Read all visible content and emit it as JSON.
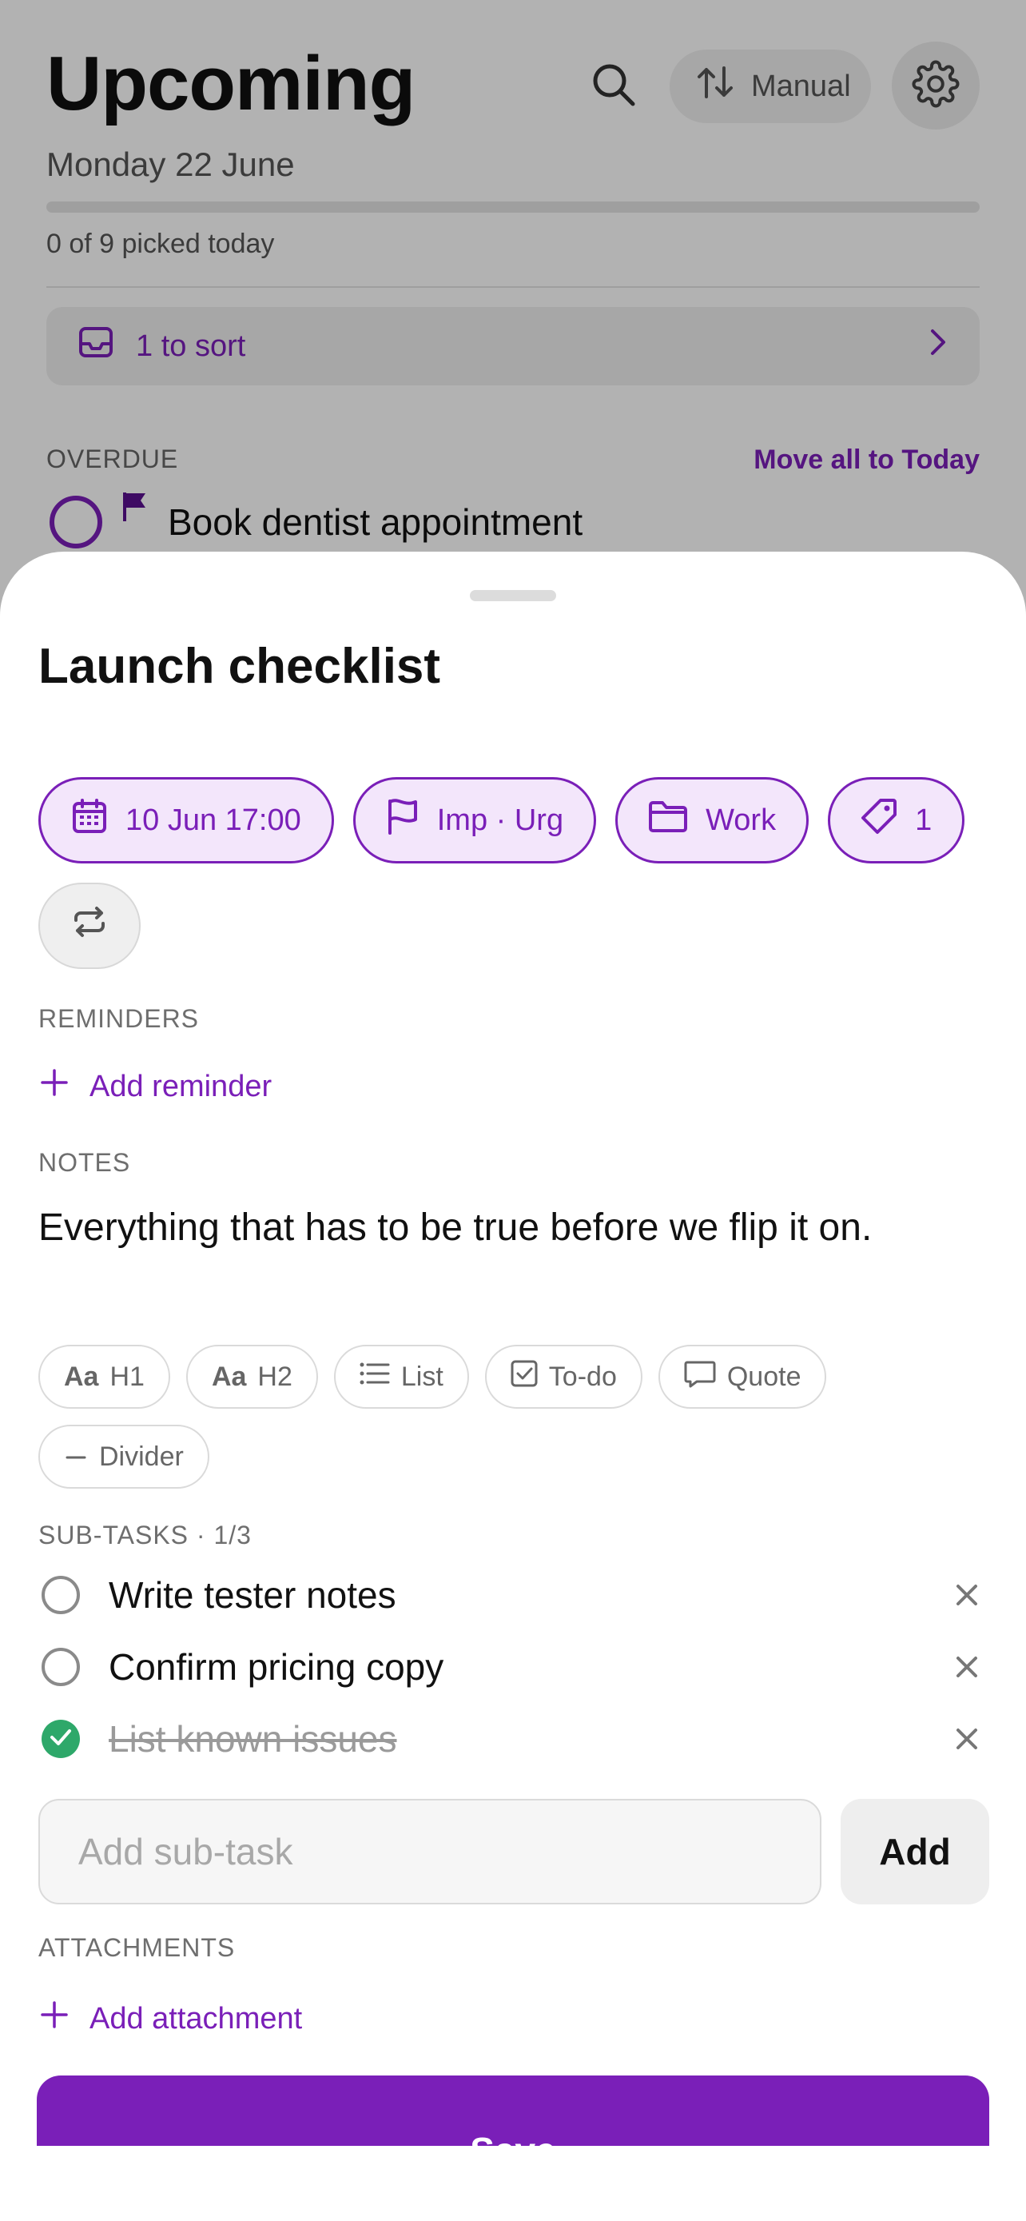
{
  "background": {
    "title": "Upcoming",
    "sort_button_label": "Manual",
    "date": "Monday 22 June",
    "progress_text": "0 of 9 picked today",
    "progress_fraction": 0,
    "to_sort_label": "1 to sort",
    "overdue_label": "OVERDUE",
    "move_all_label": "Move all to Today",
    "overdue_task": "Book dentist appointment",
    "accent_color": "#7a1fb8"
  },
  "sheet": {
    "title": "Launch checklist",
    "chips": {
      "date": "10 Jun 17:00",
      "priority": "Imp · Urg",
      "project": "Work",
      "tags_count": "1"
    },
    "reminders_label": "REMINDERS",
    "add_reminder": "Add reminder",
    "notes_label": "NOTES",
    "notes_text": "Everything that has to be true before we flip it on.",
    "format": {
      "h1": "H1",
      "h2": "H2",
      "list": "List",
      "todo": "To-do",
      "quote": "Quote",
      "divider": "Divider",
      "aa": "Aa"
    },
    "subtasks_label": "SUB-TASKS · 1/3",
    "subtasks": [
      {
        "label": "Write tester notes",
        "done": false
      },
      {
        "label": "Confirm pricing copy",
        "done": false
      },
      {
        "label": "List known issues",
        "done": true
      }
    ],
    "add_subtask_placeholder": "Add sub-task",
    "add_button": "Add",
    "attachments_label": "ATTACHMENTS",
    "add_attachment": "Add attachment",
    "save_button": "Save"
  },
  "icons": [
    "search-icon",
    "sort-arrows-icon",
    "gear-icon",
    "inbox-icon",
    "chevron-right-icon",
    "flag-icon",
    "calendar-icon",
    "folder-icon",
    "tag-icon",
    "repeat-icon",
    "plus-icon",
    "list-icon",
    "todo-checkbox-icon",
    "quote-bubble-icon",
    "divider-line-icon",
    "close-icon",
    "check-icon"
  ]
}
